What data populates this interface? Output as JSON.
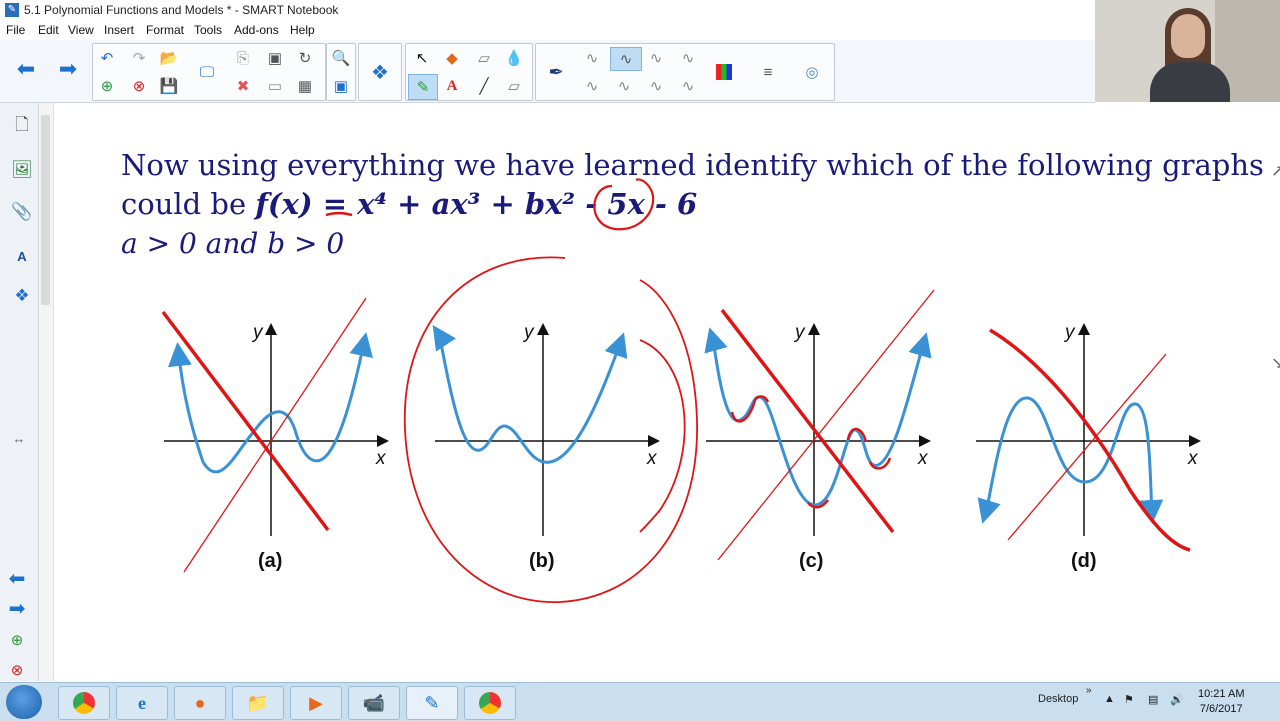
{
  "window": {
    "title": "5.1 Polynomial Functions and Models * - SMART Notebook"
  },
  "menu": [
    "File",
    "Edit",
    "View",
    "Insert",
    "Format",
    "Tools",
    "Add-ons",
    "Help"
  ],
  "toolbar_icons": [
    "back-arrow-icon",
    "forward-arrow-icon",
    "undo-icon",
    "redo-icon",
    "open-file-icon",
    "add-page-icon",
    "delete-page-icon",
    "save-icon",
    "screen-shade-icon",
    "paste-icon",
    "screen-capture-icon",
    "delete-icon",
    "display-icon",
    "table-icon",
    "document-camera-icon",
    "fullscreen-icon",
    "add-ons-icon",
    "select-icon",
    "shapes-icon",
    "eraser-icon",
    "fill-icon",
    "pen-icon",
    "text-icon",
    "line-icon",
    "eraser2-icon",
    "pen-style-icon",
    "color-palette-icon",
    "line-style-icon",
    "fill-effects-icon"
  ],
  "question": {
    "line1": "Now using everything we have learned identify which of the following graphs",
    "line2_prefix": "could be ",
    "formula": "f(x) = x⁴ + ax³ + bx² - 5x - 6",
    "condition": "a > 0 and b > 0"
  },
  "graphs": [
    {
      "label": "(a)",
      "x_axis": "x",
      "y_axis": "y"
    },
    {
      "label": "(b)",
      "x_axis": "x",
      "y_axis": "y"
    },
    {
      "label": "(c)",
      "x_axis": "x",
      "y_axis": "y"
    },
    {
      "label": "(d)",
      "x_axis": "x",
      "y_axis": "y"
    }
  ],
  "colors": {
    "curve": "#3a92d6",
    "annotation": "#e01414",
    "question_text": "#1a1a7a"
  },
  "taskbar": {
    "desktop_label": "Desktop",
    "time": "10:21 AM",
    "date": "7/6/2017"
  }
}
